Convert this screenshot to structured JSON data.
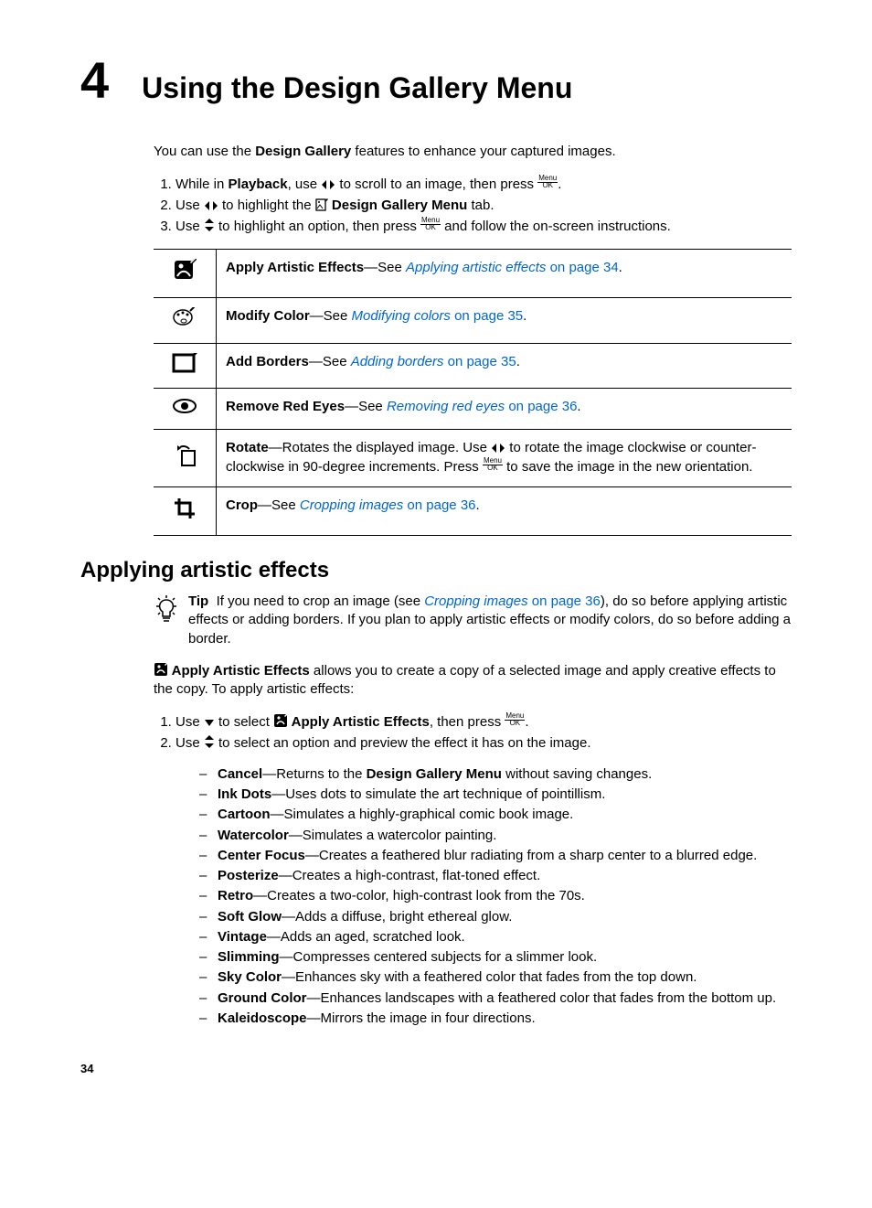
{
  "chapter": {
    "number": "4",
    "title": "Using the Design Gallery Menu"
  },
  "intro": {
    "p1_a": "You can use the ",
    "p1_b": "Design Gallery",
    "p1_c": " features to enhance your captured images.",
    "s1_a": "While in ",
    "s1_b": "Playback",
    "s1_c": ", use ",
    "s1_d": " to scroll to an image, then press ",
    "s1_e": ".",
    "s2_a": "Use ",
    "s2_b": " to highlight the ",
    "s2_c": " Design Gallery Menu",
    "s2_d": " tab.",
    "s3_a": "Use ",
    "s3_b": " to highlight an option, then press ",
    "s3_c": " and follow the on-screen instructions."
  },
  "table": {
    "r1_b": "Apply Artistic Effects",
    "r1_s": "—See ",
    "r1_l": "Applying artistic effects",
    "r1_p": " on page 34",
    "r1_e": ".",
    "r2_b": "Modify Color",
    "r2_s": "—See ",
    "r2_l": "Modifying colors",
    "r2_p": " on page 35",
    "r2_e": ".",
    "r3_b": "Add Borders",
    "r3_s": "—See ",
    "r3_l": "Adding borders",
    "r3_p": " on page 35",
    "r3_e": ".",
    "r4_b": "Remove Red Eyes",
    "r4_s": "—See ",
    "r4_l": "Removing red eyes",
    "r4_p": " on page 36",
    "r4_e": ".",
    "r5_b": "Rotate",
    "r5_s": "—Rotates the displayed image. Use ",
    "r5_m": " to rotate the image clockwise or counter-clockwise in 90-degree increments. Press ",
    "r5_t": " to save the image in the new orientation.",
    "r6_b": "Crop",
    "r6_s": "—See ",
    "r6_l": "Cropping images",
    "r6_p": " on page 36",
    "r6_e": "."
  },
  "section": {
    "heading": "Applying artistic effects",
    "tip_label": "Tip",
    "tip_a": "If you need to crop an image (see ",
    "tip_l": "Cropping images",
    "tip_lp": " on page 36",
    "tip_b": "), do so before applying artistic effects or adding borders. If you plan to apply artistic effects or modify colors, do so before adding a border.",
    "p_a": " Apply Artistic Effects",
    "p_b": " allows you to create a copy of a selected image and apply creative effects to the copy. To apply artistic effects:",
    "s1_a": "Use ",
    "s1_b": " to select ",
    "s1_c": " Apply Artistic Effects",
    "s1_d": ", then press ",
    "s1_e": ".",
    "s2_a": "Use ",
    "s2_b": " to select an option and preview the effect it has on the image."
  },
  "effects": [
    {
      "n": "Cancel",
      "d": "—Returns to the ",
      "b": "Design Gallery Menu",
      "t": " without saving changes."
    },
    {
      "n": "Ink Dots",
      "d": "—Uses dots to simulate the art technique of pointillism."
    },
    {
      "n": "Cartoon",
      "d": "—Simulates a highly-graphical comic book image."
    },
    {
      "n": "Watercolor",
      "d": "—Simulates a watercolor painting."
    },
    {
      "n": "Center Focus",
      "d": "—Creates a feathered blur radiating from a sharp center to a blurred edge."
    },
    {
      "n": "Posterize",
      "d": "—Creates a high-contrast, flat-toned effect."
    },
    {
      "n": "Retro",
      "d": "—Creates a two-color, high-contrast look from the 70s."
    },
    {
      "n": "Soft Glow",
      "d": "—Adds a diffuse, bright ethereal glow."
    },
    {
      "n": "Vintage",
      "d": "—Adds an aged, scratched look."
    },
    {
      "n": "Slimming",
      "d": "—Compresses centered subjects for a slimmer look."
    },
    {
      "n": "Sky Color",
      "d": "—Enhances sky with a feathered color that fades from the top down."
    },
    {
      "n": "Ground Color",
      "d": "—Enhances landscapes with a feathered color that fades from the bottom up."
    },
    {
      "n": "Kaleidoscope",
      "d": "—Mirrors the image in four directions."
    }
  ],
  "page_number": "34"
}
